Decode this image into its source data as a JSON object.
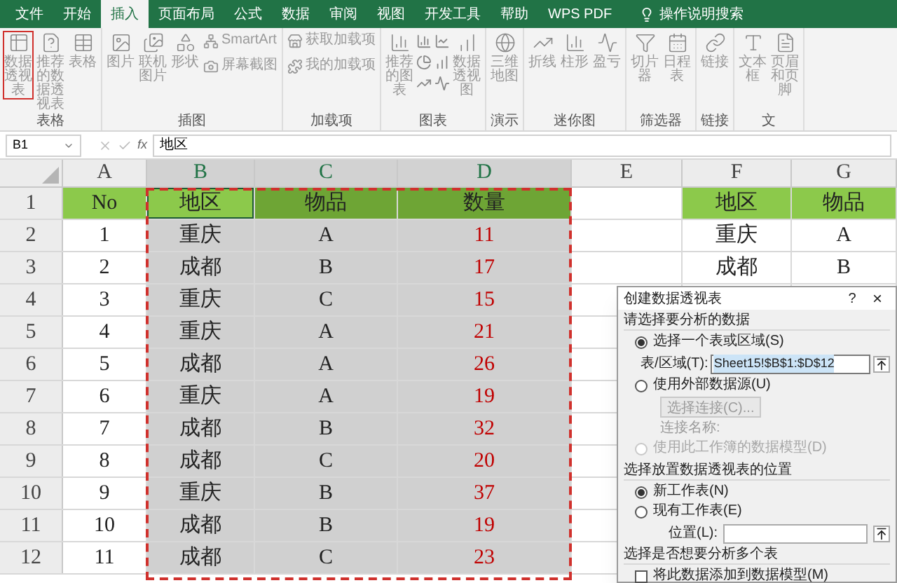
{
  "tabs": [
    {
      "label": "文件",
      "selected": false
    },
    {
      "label": "开始",
      "selected": false
    },
    {
      "label": "插入",
      "selected": true
    },
    {
      "label": "页面布局",
      "selected": false
    },
    {
      "label": "公式",
      "selected": false
    },
    {
      "label": "数据",
      "selected": false
    },
    {
      "label": "审阅",
      "selected": false
    },
    {
      "label": "视图",
      "selected": false
    },
    {
      "label": "开发工具",
      "selected": false
    },
    {
      "label": "帮助",
      "selected": false
    },
    {
      "label": "WPS PDF",
      "selected": false
    }
  ],
  "search": {
    "label": "操作说明搜索"
  },
  "ribbon": [
    {
      "label": "表格",
      "items": [
        {
          "kind": "large",
          "label": "数据透视表",
          "selected": true
        },
        {
          "kind": "large",
          "label": "推荐的数据透视表",
          "selected": false
        },
        {
          "kind": "large",
          "label": "表格",
          "selected": false
        }
      ]
    },
    {
      "label": "插图",
      "items": [
        {
          "kind": "large",
          "label": "图片",
          "selected": false
        },
        {
          "kind": "large",
          "label": "联机图片",
          "selected": false
        },
        {
          "kind": "large",
          "label": "形状",
          "selected": false
        },
        {
          "kind": "small",
          "label": "SmartArt",
          "selected": false
        },
        {
          "kind": "small",
          "label": "屏幕截图",
          "selected": false
        }
      ]
    },
    {
      "label": "加载项",
      "items": [
        {
          "kind": "small",
          "label": "获取加载项",
          "selected": false
        },
        {
          "kind": "small",
          "label": "我的加载项",
          "selected": false
        }
      ]
    },
    {
      "label": "图表",
      "items": [
        {
          "kind": "large",
          "label": "推荐的图表",
          "selected": false
        },
        {
          "kind": "gallery"
        },
        {
          "kind": "large",
          "label": "数据透视图",
          "selected": false
        }
      ]
    },
    {
      "label": "演示",
      "items": [
        {
          "kind": "large",
          "label": "三维地图",
          "selected": false
        }
      ]
    },
    {
      "label": "迷你图",
      "items": [
        {
          "kind": "large",
          "label": "折线",
          "selected": false
        },
        {
          "kind": "large",
          "label": "柱形",
          "selected": false
        },
        {
          "kind": "large",
          "label": "盈亏",
          "selected": false
        }
      ]
    },
    {
      "label": "筛选器",
      "items": [
        {
          "kind": "large",
          "label": "切片器",
          "selected": false
        },
        {
          "kind": "large",
          "label": "日程表",
          "selected": false
        }
      ]
    },
    {
      "label": "链接",
      "items": [
        {
          "kind": "large",
          "label": "链接",
          "selected": false
        }
      ]
    },
    {
      "label": "文",
      "items": [
        {
          "kind": "large",
          "label": "文本框",
          "selected": false
        },
        {
          "kind": "large",
          "label": "页眉和页脚",
          "selected": false
        }
      ]
    }
  ],
  "formula_bar": {
    "name_box": "B1",
    "function": "fx",
    "content": "地区"
  },
  "columns": [
    {
      "label": "A",
      "selected": false,
      "active": false
    },
    {
      "label": "B",
      "selected": true,
      "active": true
    },
    {
      "label": "C",
      "selected": true,
      "active": false
    },
    {
      "label": "D",
      "selected": true,
      "active": false,
      "color": "#c00000"
    },
    {
      "label": "E",
      "selected": false,
      "active": false
    },
    {
      "label": "F",
      "selected": false,
      "active": false
    },
    {
      "label": "G",
      "selected": false,
      "active": false
    }
  ],
  "rows": [
    {
      "label": "1",
      "kind": "header",
      "cells": [
        "No",
        "地区",
        "物品",
        "数量",
        null,
        "地区",
        "物品"
      ]
    },
    {
      "label": "2",
      "kind": "data",
      "cells": [
        "1",
        "重庆",
        "A",
        "11",
        null,
        "重庆",
        "A"
      ]
    },
    {
      "label": "3",
      "kind": "data",
      "cells": [
        "2",
        "成都",
        "B",
        "17",
        null,
        "成都",
        "B"
      ]
    },
    {
      "label": "4",
      "kind": "data",
      "cells": [
        "3",
        "重庆",
        "C",
        "15",
        null,
        null,
        null
      ]
    },
    {
      "label": "5",
      "kind": "data",
      "cells": [
        "4",
        "重庆",
        "A",
        "21",
        null,
        null,
        null
      ]
    },
    {
      "label": "6",
      "kind": "data",
      "cells": [
        "5",
        "成都",
        "A",
        "26",
        null,
        null,
        null
      ]
    },
    {
      "label": "7",
      "kind": "data",
      "cells": [
        "6",
        "重庆",
        "A",
        "19",
        null,
        null,
        null
      ]
    },
    {
      "label": "8",
      "kind": "data",
      "cells": [
        "7",
        "成都",
        "B",
        "32",
        null,
        null,
        null
      ]
    },
    {
      "label": "9",
      "kind": "data",
      "cells": [
        "8",
        "成都",
        "C",
        "20",
        null,
        null,
        null
      ]
    },
    {
      "label": "10",
      "kind": "data",
      "cells": [
        "9",
        "重庆",
        "B",
        "37",
        null,
        null,
        null
      ]
    },
    {
      "label": "11",
      "kind": "data",
      "cells": [
        "10",
        "成都",
        "B",
        "19",
        null,
        null,
        null
      ]
    },
    {
      "label": "12",
      "kind": "data",
      "cells": [
        "11",
        "成都",
        "C",
        "23",
        null,
        null,
        null
      ]
    }
  ],
  "dialog": {
    "title": "创建数据透视表",
    "help": "?",
    "close": "×",
    "source_heading": "请选择要分析的数据",
    "source_options": [
      {
        "label": "选择一个表或区域(S)",
        "selected": true
      },
      {
        "label": "使用外部数据源(U)",
        "selected": false
      }
    ],
    "range_field": {
      "label": "表/区域(T):",
      "value": "Sheet15!$B$1:$D$12"
    },
    "connection_button": {
      "label": "选择连接(C)...",
      "disabled": true
    },
    "connection_name": {
      "label": "连接名称:",
      "disabled": true
    },
    "data_model_option": {
      "label": "使用此工作簿的数据模型(D)",
      "selected": false,
      "disabled": true
    },
    "location_heading": "选择放置数据透视表的位置",
    "location_options": [
      {
        "label": "新工作表(N)",
        "selected": true
      },
      {
        "label": "现有工作表(E)",
        "selected": false
      }
    ],
    "location_field": {
      "label": "位置(L):"
    },
    "multi_heading": "选择是否想要分析多个表",
    "add_to_model": {
      "label": "将此数据添加到数据模型(M)",
      "checked": false
    }
  }
}
